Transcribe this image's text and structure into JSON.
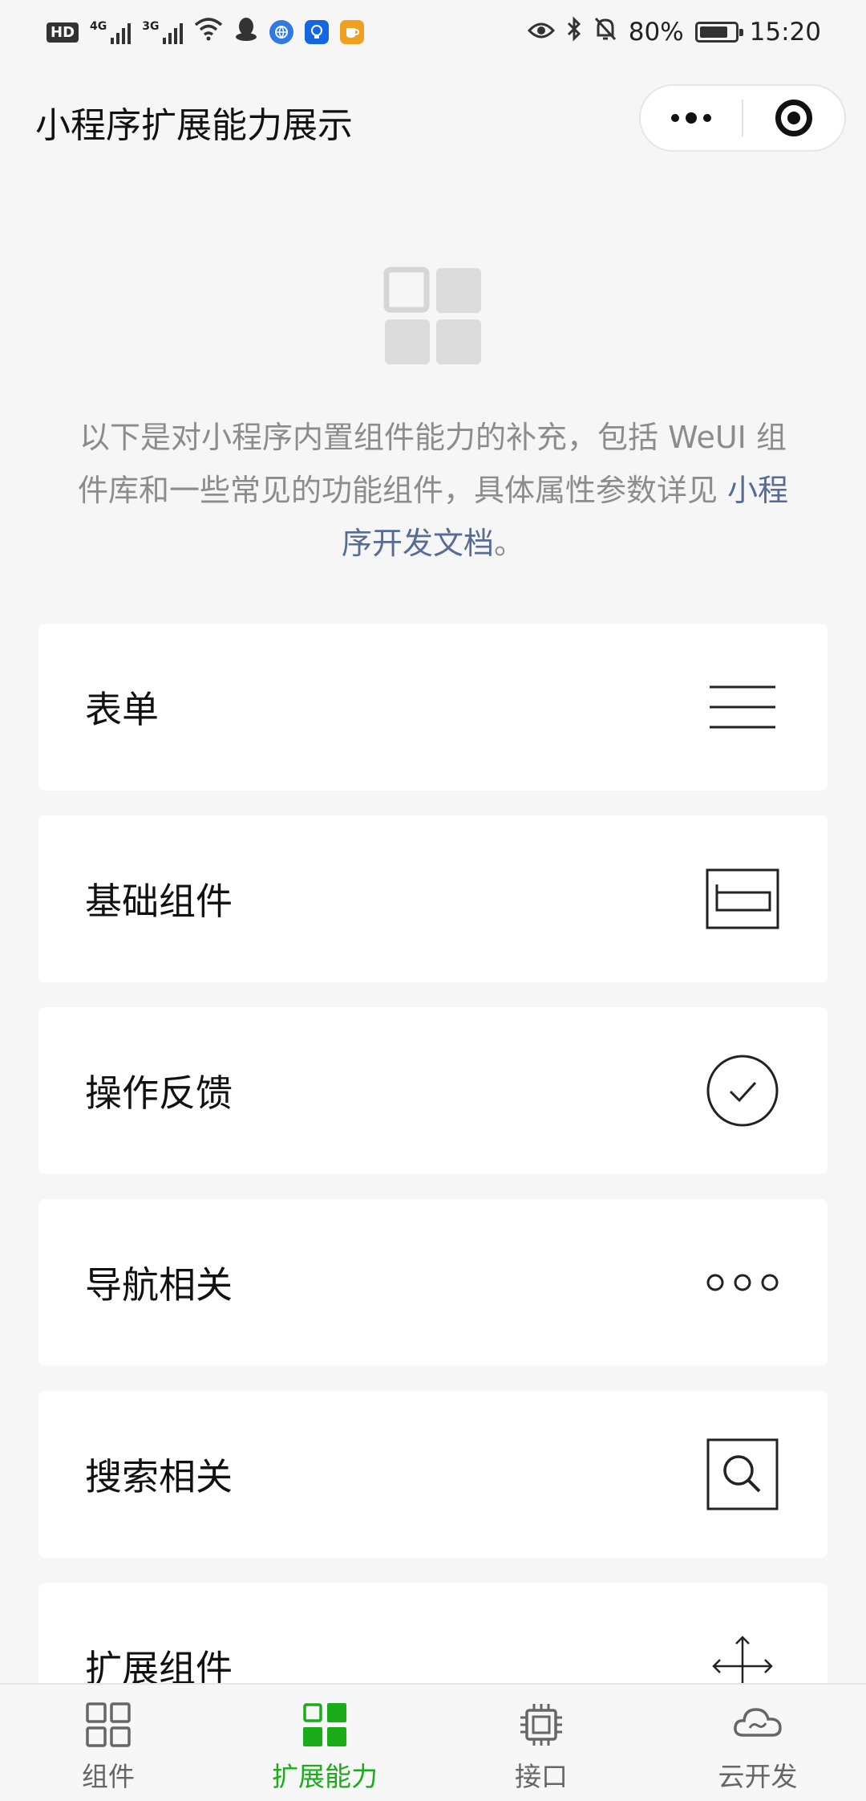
{
  "status_bar": {
    "hd_badge": "HD",
    "sig1_label": "4G",
    "sig2_label": "3G",
    "battery_percent": "80%",
    "battery_level": 0.8,
    "time": "15:20"
  },
  "header": {
    "title": "小程序扩展能力展示",
    "menu_icon": "more-dots-icon",
    "close_icon": "target-icon"
  },
  "intro": {
    "text_before": "以下是对小程序内置组件能力的补充，包括 WeUI 组件库和一些常见的功能组件，具体属性参数详见 ",
    "link": "小程序开发文档",
    "text_after": "。"
  },
  "menu": {
    "items": [
      {
        "label": "表单",
        "icon": "form-lines-icon"
      },
      {
        "label": "基础组件",
        "icon": "basic-component-icon"
      },
      {
        "label": "操作反馈",
        "icon": "check-circle-icon"
      },
      {
        "label": "导航相关",
        "icon": "three-dots-icon"
      },
      {
        "label": "搜索相关",
        "icon": "search-icon"
      },
      {
        "label": "扩展组件",
        "icon": "expand-arrows-icon"
      }
    ]
  },
  "tab_bar": {
    "tabs": [
      {
        "label": "组件",
        "icon": "grid-icon",
        "active": false
      },
      {
        "label": "扩展能力",
        "icon": "grid-filled-icon",
        "active": true
      },
      {
        "label": "接口",
        "icon": "chip-icon",
        "active": false
      },
      {
        "label": "云开发",
        "icon": "cloud-icon",
        "active": false
      }
    ]
  },
  "colors": {
    "accent_green": "#1aad19",
    "link_blue": "#576b95",
    "muted_text": "#8c8c8c",
    "background": "#f6f6f6"
  }
}
